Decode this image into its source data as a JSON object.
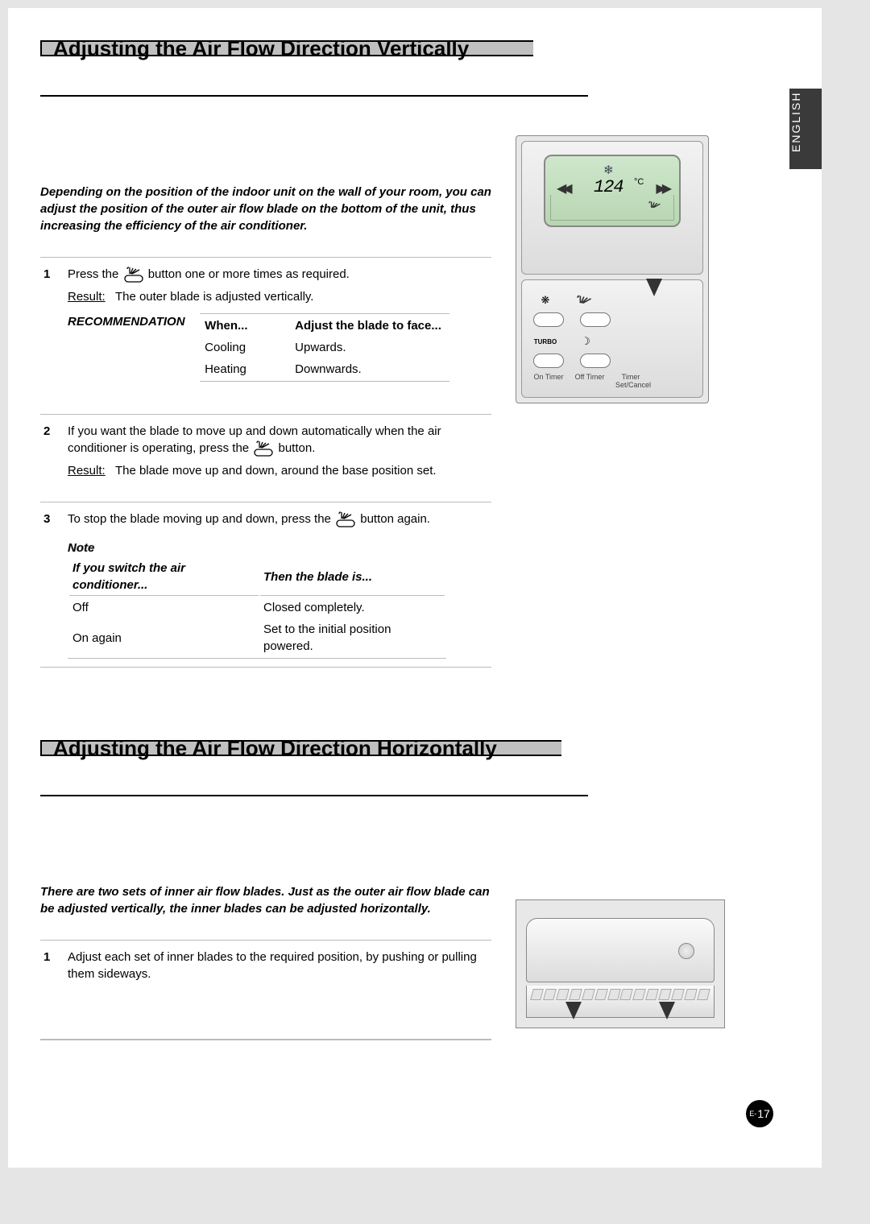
{
  "language_tab": "ENGLISH",
  "page_number_prefix": "E-",
  "page_number": "17",
  "section1": {
    "title": "Adjusting the Air Flow Direction Vertically",
    "intro": "Depending on the position of the indoor unit on the wall of your room, you can adjust the position of the outer air flow blade on the bottom of the unit, thus increasing the efficiency of the air conditioner.",
    "step1": {
      "num": "1",
      "text_a": "Press the",
      "text_b": "button one or more times as required.",
      "result_label": "Result",
      "result_text": "The outer blade is adjusted vertically."
    },
    "recommendation": {
      "label": "RECOMMENDATION",
      "col1": "When...",
      "col2": "Adjust the blade to face...",
      "rows": [
        {
          "when": "Cooling",
          "face": "Upwards."
        },
        {
          "when": "Heating",
          "face": "Downwards."
        }
      ]
    },
    "step2": {
      "num": "2",
      "text_a": "If you want the blade to move up and down automatically when the air conditioner is operating, press the",
      "text_b": "button.",
      "result_label": "Result",
      "result_text": "The blade move up and down, around the base position set."
    },
    "step3": {
      "num": "3",
      "text_a": "To stop the blade moving up and down, press the",
      "text_b": "button again."
    },
    "note": {
      "label": "Note",
      "col1": "If you switch the air conditioner...",
      "col2": "Then the blade is...",
      "rows": [
        {
          "a": "Off",
          "b": "Closed completely."
        },
        {
          "a": "On again",
          "b": "Set to the initial position powered."
        }
      ]
    }
  },
  "section2": {
    "title": "Adjusting the Air Flow Direction Horizontally",
    "intro": "There are two sets of inner air flow blades. Just as the outer air flow blade can be adjusted vertically, the inner blades can be adjusted horizontally.",
    "step1": {
      "num": "1",
      "text": "Adjust each set of inner blades to the required position, by pushing or pulling them sideways."
    }
  },
  "remote": {
    "temperature": "124",
    "unit": "°C",
    "labels": {
      "on_timer": "On Timer",
      "off_timer": "Off Timer",
      "timer_set": "Timer Set/Cancel"
    },
    "icons": {
      "snowflake": "snowflake",
      "blade": "blade",
      "turbo_text": "TURBO"
    }
  }
}
